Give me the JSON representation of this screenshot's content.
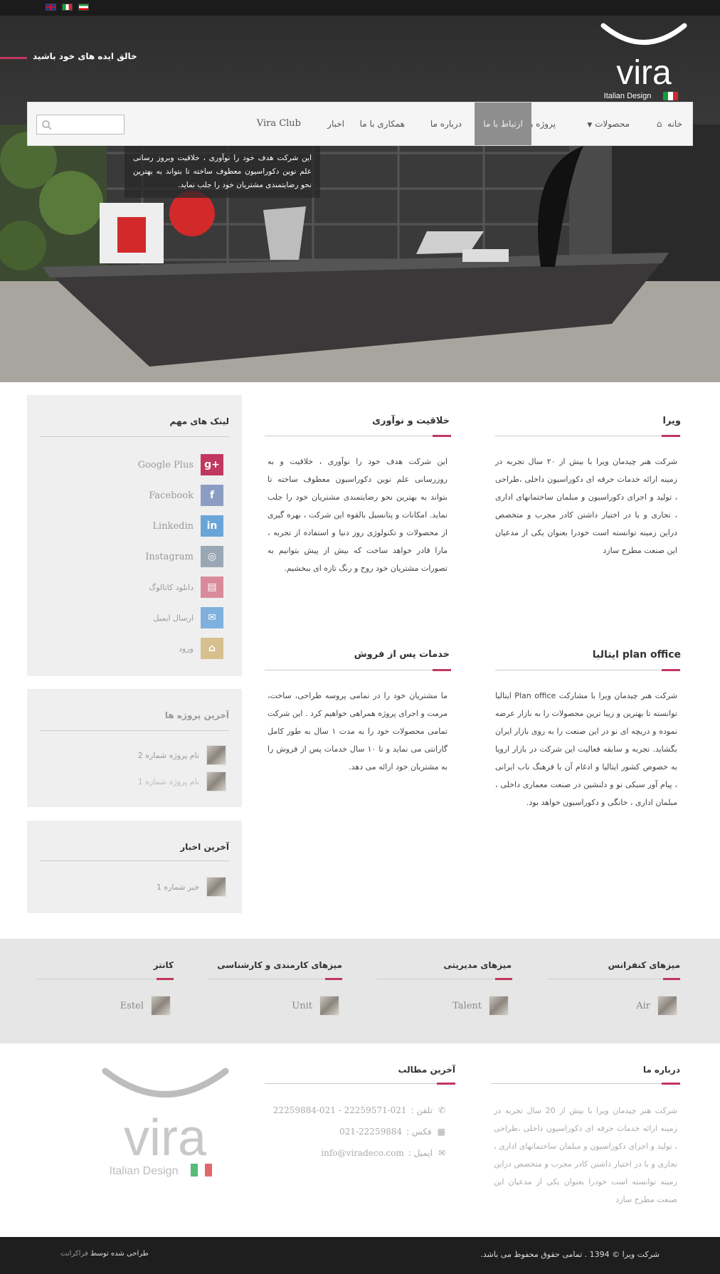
{
  "header": {
    "tagline": "خالق ایده های خود باشید",
    "logo_text": "vira",
    "logo_sub": "Italian Design"
  },
  "languages": [
    "English",
    "Italiano",
    "فارسی"
  ],
  "nav": {
    "home": "خانه",
    "products": "محصولات",
    "projects": "پروژه ها",
    "contact": "ارتباط با ما",
    "about": "درباره ما",
    "cooperation": "همکاری با ما",
    "news": "اخبار",
    "club": "Vira Club",
    "search_placeholder": ""
  },
  "hero": {
    "caption": "این شرکت هدف خود را نوآوری ، خلاقیت  وبروز رسانی علم نوین دکوراسیون معطوف ساخته تا بتواند به بهترین نحو رضایتمندی مشتریان خود را جلب نماید."
  },
  "main": {
    "vira": {
      "title": "ویرا",
      "text": "شرکت هنر چیدمان ویرا با بیش از ۲۰ سال تجربه در زمینه ارائه خدمات حرفه ای دکوراسیون داخلی ،طراحی ، تولید و اجرای دکوراسیون و مبلمان ساختمانهای اداری ، تجاری و با در اختیار داشتن کادر مجرب و متخصص دراین زمینه توانسته است خودرا بعنوان یکی از مدعیان این صنعت مطرح سازد"
    },
    "creativity": {
      "title": "خلاقیت و نوآوری",
      "text": "این شرکت هدف خود را نوآوری ، خلاقیت و به روزرسانی علم نوین دکوراسیون معطوف ساخته تا بتواند به بهترین نحو رضایتمندی مشتریان خود را جلب نماید. امکانات و پتانسیل بالقوه این شرکت ، بهره گیری از محصولات و تکنولوژی روز دنیا و استفاده از تجربه ، مارا قادر خواهد ساخت که بیش از پیش بتوانیم به تصورات مشتریان خود روح و رنگ تازه ای ببخشیم."
    },
    "planoffice": {
      "title": "plan office ایتالیا",
      "text": "شرکت هنر چیدمان ویرا با مشارکت Plan office ایتالیا توانسته تا بهترین و زیبا ترین محصولات را به بازار عرضه نموده و دریچه ای نو در این صنعت را به روی بازار ایران بگشاید. تجربه و سابقه فعالیت این شرکت در بازار اروپا به خصوص کشور ایتالیا و ادغام آن با فرهنگ ناب ایرانی ، پیام آور سبکی نو و دلنشین در صنعت معماری داخلی ، مبلمان اداری ، خانگی و دکوراسیون خواهد بود."
    },
    "aftersales": {
      "title": "خدمات پس از فروش",
      "text": "ما مشتریان خود را در تمامی پروسه طراحی، ساخت، مرمت و اجرای پروژه همراهی خواهیم کرد . این شرکت تمامی محصولات خود را به مدت ۱ سال به طور کامل گارانتی می نماید و تا ۱۰ سال خدمات پس از فروش را به مشتریان خود ارائه می دهد."
    }
  },
  "sidebar": {
    "links_title": "لینک های مهم",
    "links": [
      {
        "label": "Google Plus",
        "icon": "google-plus-icon",
        "color": "#c0385f",
        "glyph": "g+"
      },
      {
        "label": "Facebook",
        "icon": "facebook-icon",
        "color": "#8b9dc3",
        "glyph": "f"
      },
      {
        "label": "Linkedin",
        "icon": "linkedin-icon",
        "color": "#6aa5d8",
        "glyph": "in"
      },
      {
        "label": "Instagram",
        "icon": "instagram-icon",
        "color": "#9aa8b5",
        "glyph": "◎"
      },
      {
        "label": "دانلود کاتالوگ",
        "icon": "catalog-icon",
        "color": "#d98a9a",
        "glyph": "▤"
      },
      {
        "label": "ارسال ایمیل",
        "icon": "email-icon",
        "color": "#7fb0de",
        "glyph": "✉"
      },
      {
        "label": "ورود",
        "icon": "lock-icon",
        "color": "#d7c08e",
        "glyph": "🔓"
      }
    ],
    "projects_title": "آخرین پروژه ها",
    "projects": [
      "نام پروژه شماره 2",
      "نام پروژه شماره 1"
    ],
    "news_title": "آخرین اخبار",
    "news": [
      "خبر شماره 1"
    ]
  },
  "products": [
    {
      "title": "میزهای کنفرانس",
      "item": "Air"
    },
    {
      "title": "میزهای مدیریتی",
      "item": "Talent"
    },
    {
      "title": "میزهای کارمندی و کارشناسی",
      "item": "Unit"
    },
    {
      "title": "کانتر",
      "item": "Estel"
    }
  ],
  "footer": {
    "about_title": "درباره ما",
    "about_text": "شرکت هنر چیدمان ویرا با بیش از 20 سال تجربه در زمینه ارائه خدمات حرفه ای دکوراسیون داخلی ،طراحی ، تولید و اجرای دکوراسیون و مبلمان ساختمانهای اداری ، تجاری و با در اختیار داشتن کادر مجرب و متخصص دراین زمینه توانسته است خودرا بعنوان یکی از مدعیان این صنعت مطرح سازد",
    "posts_title": "آخرین مطالب",
    "phone_label": "تلفن :",
    "phone": "22259884-021 - 22259571-021",
    "fax_label": "فکس :",
    "fax": "021-22259884",
    "email_label": "ایمیل :",
    "email": "info@viradeco.com",
    "copyright": "شرکت ویرا © 1394 . تمامی حقوق محفوظ می باشد.",
    "credit_prefix": "طراحی شده توسط",
    "credit_brand": "فراکرانت"
  },
  "colors": {
    "accent": "#c0385f",
    "dark": "#2e2d2e",
    "topbar": "#1b1b1b"
  }
}
